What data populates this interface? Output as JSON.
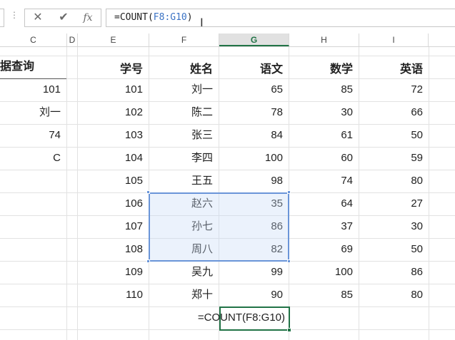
{
  "formula_bar": {
    "cancel_icon": "✕",
    "enter_icon": "✔",
    "fx_label": "fx",
    "formula_prefix": "=COUNT(",
    "formula_ref": "F8:G10",
    "formula_suffix": ")",
    "menu_dots": "⋮"
  },
  "columns": [
    {
      "label": "C"
    },
    {
      "label": "D"
    },
    {
      "label": "E"
    },
    {
      "label": "F"
    },
    {
      "label": "G",
      "active": true
    },
    {
      "label": "H"
    },
    {
      "label": "I"
    }
  ],
  "side_table": {
    "title": "据查询",
    "values": [
      "101",
      "刘一",
      "74",
      "C"
    ]
  },
  "main_table": {
    "headers": [
      "学号",
      "姓名",
      "语文",
      "数学",
      "英语"
    ],
    "rows": [
      [
        "101",
        "刘一",
        "65",
        "85",
        "72"
      ],
      [
        "102",
        "陈二",
        "78",
        "30",
        "66"
      ],
      [
        "103",
        "张三",
        "84",
        "61",
        "50"
      ],
      [
        "104",
        "李四",
        "100",
        "60",
        "59"
      ],
      [
        "105",
        "王五",
        "98",
        "74",
        "80"
      ],
      [
        "106",
        "赵六",
        "35",
        "64",
        "27"
      ],
      [
        "107",
        "孙七",
        "86",
        "37",
        "30"
      ],
      [
        "108",
        "周八",
        "82",
        "69",
        "50"
      ],
      [
        "109",
        "吴九",
        "99",
        "100",
        "86"
      ],
      [
        "110",
        "郑十",
        "90",
        "85",
        "80"
      ]
    ],
    "formula_cell": "=COUNT(F8:G10)"
  },
  "colors": {
    "selection_border": "#6a95d8",
    "active_cell_border": "#217346",
    "formula_ref": "#3a72c4"
  }
}
